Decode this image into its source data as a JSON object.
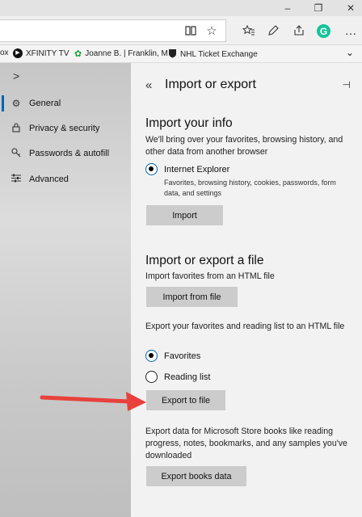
{
  "window": {
    "minimize": "–",
    "restore": "❐",
    "close": "✕"
  },
  "toolbar": {
    "icons": [
      "reading-view-icon",
      "favorite-star-icon",
      "favorites-hub-icon",
      "pen-icon",
      "share-icon",
      "grammarly-icon",
      "more-icon"
    ],
    "grammarly_label": "G",
    "more_label": "…"
  },
  "favorites": {
    "items": [
      {
        "label": "ox"
      },
      {
        "label": "XFINITY TV"
      },
      {
        "label": "Joanne B. | Franklin, M"
      },
      {
        "label": "NHL Ticket Exchange"
      }
    ],
    "expand_label": "⌄"
  },
  "sidebar": {
    "expand_label": ">",
    "items": [
      {
        "label": "General",
        "icon": "gear-icon",
        "active": true
      },
      {
        "label": "Privacy & security",
        "icon": "lock-icon"
      },
      {
        "label": "Passwords & autofill",
        "icon": "key-icon"
      },
      {
        "label": "Advanced",
        "icon": "sliders-icon"
      }
    ]
  },
  "panel": {
    "back_label": "«",
    "title": "Import or export",
    "pin_label": "⊣",
    "import_info": {
      "heading": "Import your info",
      "description": "We'll bring over your favorites, browsing history, and other data from another browser",
      "source_label": "Internet Explorer",
      "source_detail": "Favorites, browsing history, cookies, passwords, form data, and settings",
      "import_button": "Import"
    },
    "file": {
      "heading": "Import or export a file",
      "import_desc": "Import favorites from an HTML file",
      "import_button": "Import from file",
      "export_desc": "Export your favorites and reading list to an HTML file",
      "options": [
        {
          "label": "Favorites",
          "selected": true
        },
        {
          "label": "Reading list",
          "selected": false
        }
      ],
      "export_button": "Export to file"
    },
    "books": {
      "description": "Export data for Microsoft Store books like reading progress, notes, bookmarks, and any samples you've downloaded",
      "button": "Export books data"
    }
  },
  "colors": {
    "accent": "#0063b1",
    "arrow": "#e8413c",
    "button": "#cccccc"
  }
}
